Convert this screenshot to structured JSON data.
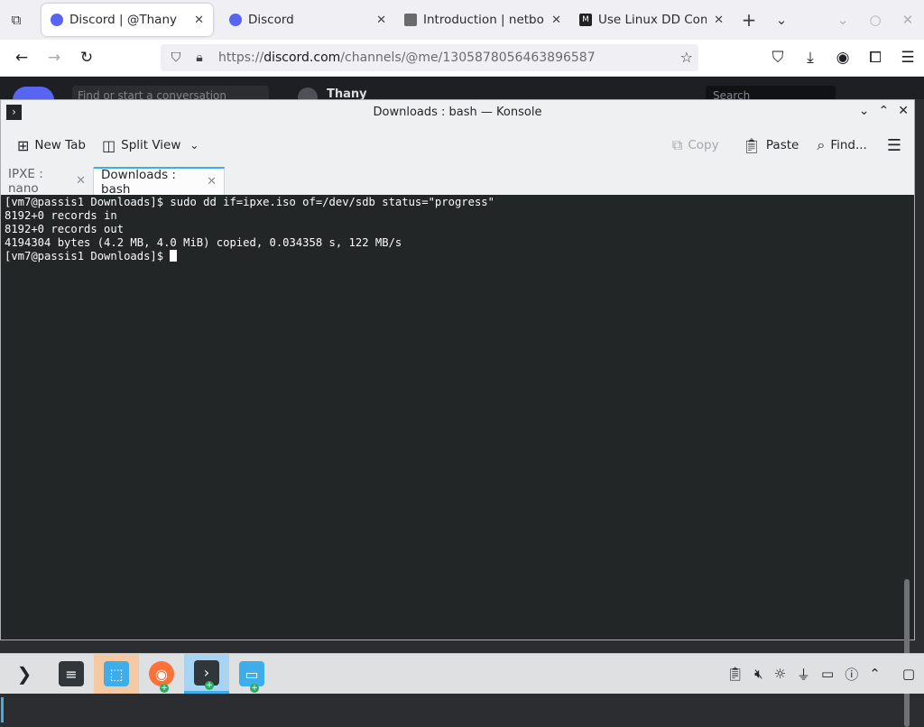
{
  "browser": {
    "tabs": [
      {
        "title": "Discord | @Thany",
        "favicon": "discord-icon",
        "color": "#5865f2",
        "active": true
      },
      {
        "title": "Discord",
        "favicon": "discord-icon",
        "color": "#5865f2",
        "active": false
      },
      {
        "title": "Introduction | netbo",
        "favicon": "netbox-icon",
        "color": "#6a6a6a",
        "active": false
      },
      {
        "title": "Use Linux DD Comma",
        "favicon": "medium-icon",
        "color": "#222222",
        "active": false
      }
    ],
    "url": {
      "prefix": "https://",
      "domain": "discord.com",
      "path": "/channels/@me/1305878056463896587"
    }
  },
  "discord": {
    "find_placeholder": "Find or start a conversation",
    "user_name": "Thany",
    "search_placeholder": "Search"
  },
  "konsole": {
    "title": "Downloads : bash — Konsole",
    "toolbar": {
      "new_tab": "New Tab",
      "split_view": "Split View",
      "copy": "Copy",
      "paste": "Paste",
      "find": "Find..."
    },
    "tabs": [
      {
        "label": "IPXE : nano",
        "active": false
      },
      {
        "label": "Downloads : bash",
        "active": true
      }
    ],
    "terminal_lines": [
      "[vm7@passis1 Downloads]$ sudo dd if=ipxe.iso of=/dev/sdb status=\"progress\"",
      "8192+0 records in",
      "8192+0 records out",
      "4194304 bytes (4.2 MB, 4.0 MiB) copied, 0.034358 s, 122 MB/s"
    ],
    "prompt": "[vm7@passis1 Downloads]$ "
  },
  "colors": {
    "accent": "#3daee9",
    "terminal_bg": "#232627",
    "terminal_fg": "#fcfcfc",
    "discord_blurple": "#5865f2"
  }
}
